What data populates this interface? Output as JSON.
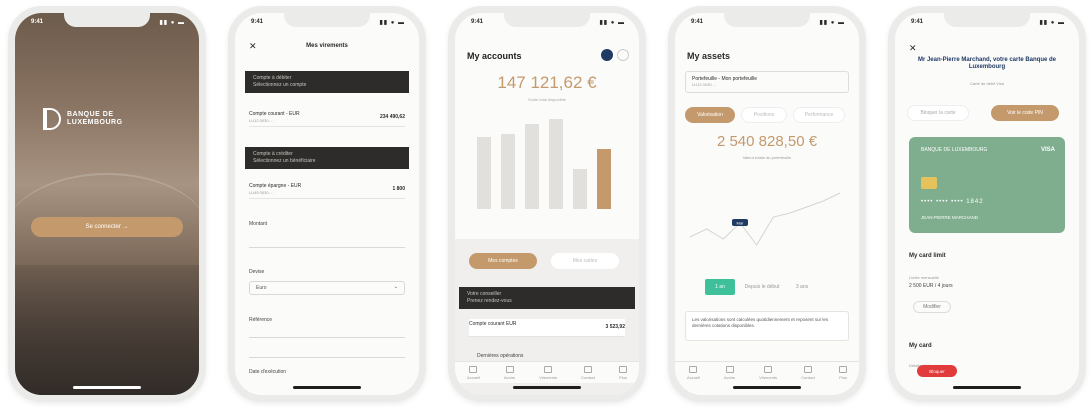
{
  "status": {
    "time": "9:41",
    "signal": "▮▮ ● ▬"
  },
  "phone1": {
    "bank_line1": "BANQUE DE",
    "bank_line2": "LUXEMBOURG",
    "cta": "Se connecter →"
  },
  "phone2": {
    "close": "✕",
    "title": "Mes virements",
    "banner1_l1": "Compte à débiter",
    "banner1_l2": "Sélectionnez un compte",
    "row1": {
      "name": "Compte courant - EUR",
      "sub": "LU12 0030 ...",
      "amount": "234 490,62"
    },
    "banner2_l1": "Compte à créditer",
    "banner2_l2": "Sélectionnez un bénéficiaire",
    "row2": {
      "name": "Compte épargne - EUR",
      "sub": "LU45 0030 ...",
      "amount": "1 800"
    },
    "label_amount": "Montant",
    "label_currency": "Devise",
    "select_value": "Euro",
    "label_ref": "Référence",
    "label_date": "Date d'exécution"
  },
  "phone3": {
    "title": "My accounts",
    "balance": "147 121,62 €",
    "balance_sub": "Solde total disponible",
    "pill_active": "Mes comptes",
    "pill_inactive": "Mes cartes",
    "banner_l1": "Votre conseiller",
    "banner_l2": "Prenez rendez-vous",
    "row_name": "Compte courant EUR",
    "row_amount": "3 523,92",
    "recent": "Dernières opérations",
    "tabs": [
      "Accueil",
      "Avoirs",
      "Virements",
      "Contact",
      "Plus"
    ]
  },
  "phone4": {
    "title": "My assets",
    "select_l1": "Portefeuille - Mon portefeuille",
    "select_l2": "LU12 0030 ...",
    "pills": [
      "Valorisation",
      "Positions",
      "Performance"
    ],
    "balance": "2 540 828,50 €",
    "balance_sub": "Valeur totale du portefeuille",
    "tooltip": "Mar",
    "range_active": "1 an",
    "range_others": [
      "Depuis le début",
      "3 ans"
    ],
    "note": "Les valorisations sont calculées quotidiennement et reposent sur les dernières cotations disponibles.",
    "tabs": [
      "Accueil",
      "Avoirs",
      "Virements",
      "Contact",
      "Plus"
    ]
  },
  "phone5": {
    "close": "✕",
    "heading": "Mr Jean-Pierre Marchand, votre carte Banque de Luxembourg",
    "sub": "Carte de débit Visa",
    "pill_left": "Bloquer la carte",
    "pill_right": "Voir le code PIN",
    "card_bank": "BANQUE DE LUXEMBOURG",
    "card_brand": "VISA",
    "card_number": "•••• •••• •••• 1842",
    "card_holder": "JEAN-PIERRE MARCHAND",
    "sect1": "My card limit",
    "limit_label": "Limite mensuelle",
    "limit_value": "2 500 EUR / 4 jours",
    "limit_btn": "Modifier",
    "sect2": "My card",
    "card_sub": "Détails de la carte",
    "red_btn": "Bloquer"
  },
  "colors": {
    "gold": "#c49a6c",
    "dark": "#2e2c2b",
    "navy": "#1f3a63",
    "card_green": "#7fae8f",
    "red": "#e23b3b"
  },
  "chart_bars": [
    72,
    75,
    85,
    90,
    40,
    60
  ],
  "asset_points": [
    48,
    52,
    47,
    55,
    44,
    58,
    60,
    63,
    66,
    70
  ]
}
